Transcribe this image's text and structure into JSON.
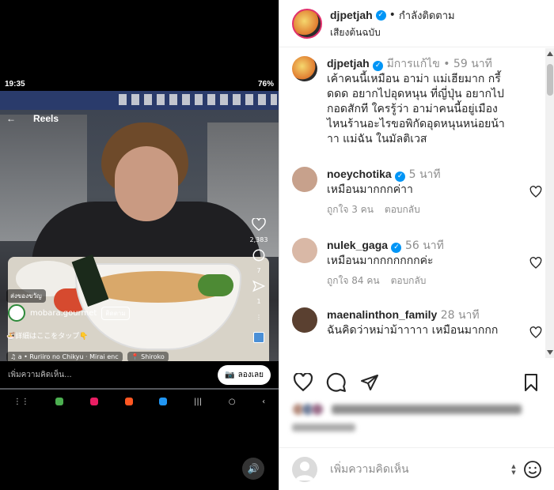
{
  "status_bar": {
    "time": "19:35",
    "battery": "76%"
  },
  "reels": {
    "title": "Reels",
    "like_count": "2,383",
    "comment_count": "7",
    "share_count": "1",
    "promo_label": "ส่งของขวัญ",
    "account_name": "mobara.gourmet",
    "follow_label": "ติดตาม",
    "caption": "🍜詳細はここをタップ👇",
    "music": "♫ a • Ruriiro no Chikyu · Mirai enc",
    "location": "📍 Shiroko",
    "comment_placeholder": "เพิ่มความคิดเห็น...",
    "try_button": "ลองเลย"
  },
  "header": {
    "username": "djpetjah",
    "following_label": "กำลังติดตาม",
    "audio_label": "เสียงต้นฉบับ"
  },
  "comments": [
    {
      "username": "djpetjah",
      "meta": "มีการแก้ไข • 59 นาที",
      "text": "เค้าคนนี้เหมือน อาม่า แม่เฮียมาก กรี้ดดด อยากไปอุดหนุน ที่ญี่ปุ่น อยากไปกอดสักที ใครรู้ว่า อาม่าคนนี้อยู่เมืองไหนร้านอะไรขอพิกัดอุดหนุนหน่อยน้าาา แม่ฉัน ในมัลติเวส",
      "avatar_color": "#e8a33a"
    },
    {
      "username": "noeychotika",
      "meta": "5 นาที",
      "text": "เหมือนมากกกค่าา",
      "likes": "ถูกใจ 3 คน",
      "reply": "ตอบกลับ",
      "avatar_color": "#c7a18c"
    },
    {
      "username": "nulek_gaga",
      "meta": "56 นาที",
      "text": "เหมือนมากกกกกกกค่ะ",
      "likes": "ถูกใจ 84 คน",
      "reply": "ตอบกลับ",
      "avatar_color": "#d9b8a6"
    },
    {
      "username": "maenalinthon_family",
      "meta": "28 นาที",
      "text": "ฉันคิดว่าหม่าม้าาาาา เหมือนมากกก",
      "avatar_color": "#5a4030"
    }
  ],
  "add_comment": {
    "placeholder": "เพิ่มความคิดเห็น"
  },
  "colors": {
    "verified": "#0095f6",
    "muted": "#8e8e8e",
    "text": "#262626"
  }
}
